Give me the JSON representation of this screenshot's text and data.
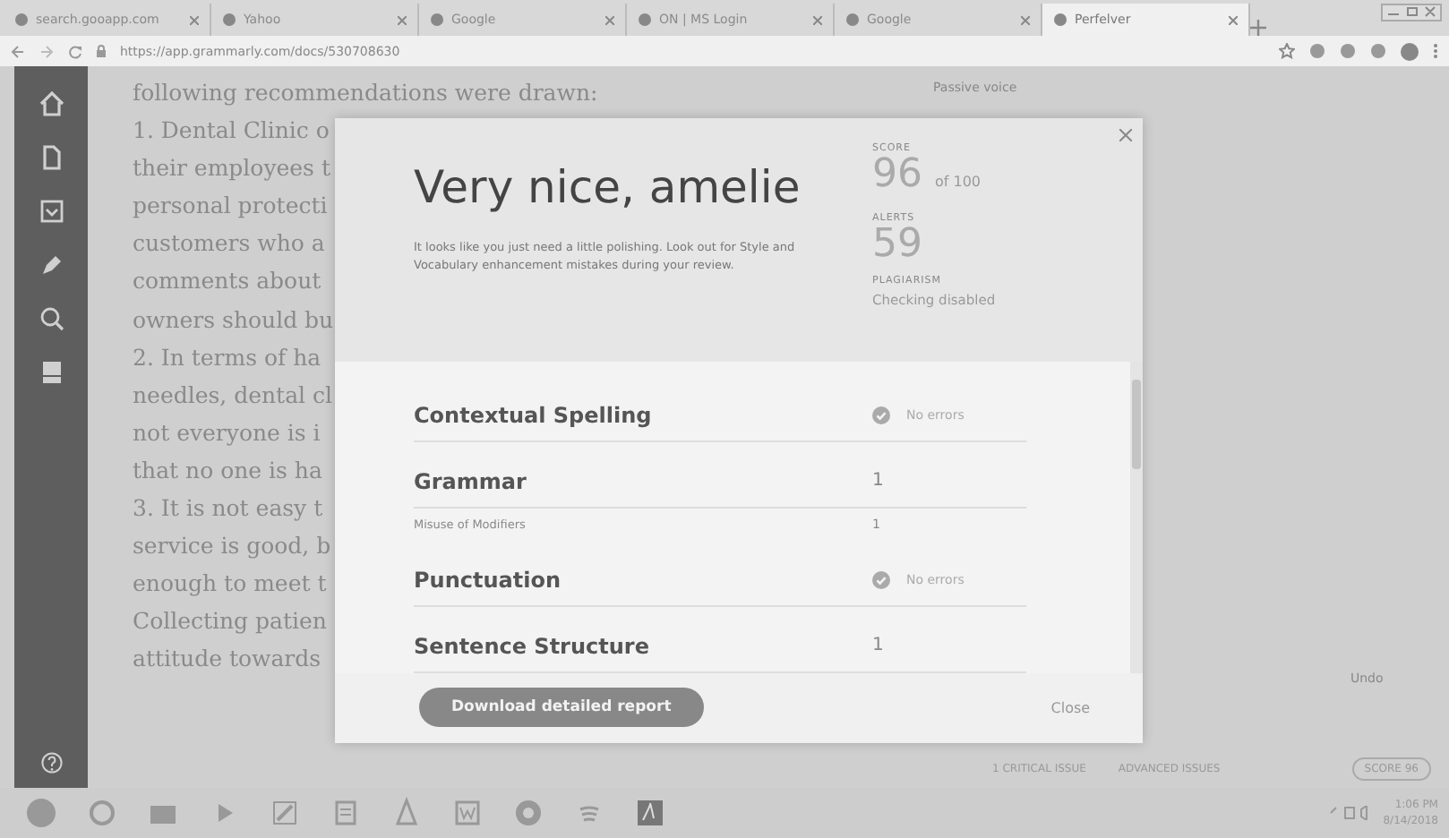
{
  "browser": {
    "tabs": [
      {
        "title": "search.gooapp.com",
        "selected": false
      },
      {
        "title": "Yahoo",
        "selected": false
      },
      {
        "title": "Google",
        "selected": false
      },
      {
        "title": "ON | MS Login",
        "selected": false
      },
      {
        "title": "Google",
        "selected": false
      },
      {
        "title": "Perfelver",
        "selected": true
      }
    ],
    "url": "https://app.grammarly.com/docs/530708630"
  },
  "document": {
    "lines": [
      "following recommendations were drawn:",
      "1. Dental Clinic o",
      "their employees t",
      "personal protecti",
      "customers who a",
      "comments about",
      "owners should bu",
      "2. In terms of ha",
      "needles, dental cl",
      "not everyone is i",
      "that no one is ha",
      "3. It is not easy t",
      "service is good, b",
      "enough to meet t",
      "Collecting patien",
      "attitude towards"
    ],
    "side_label": "Passive voice",
    "undo": "Undo",
    "status_bar": {
      "critical": "1 CRITICAL ISSUE",
      "advanced": "ADVANCED ISSUES",
      "score": "SCORE 96"
    }
  },
  "report": {
    "title": "Very nice, amelie",
    "message": "It looks like you just need a little polishing. Look out for Style and Vocabulary enhancement mistakes during your review.",
    "score": {
      "label": "SCORE",
      "value": "96",
      "suffix": "of 100"
    },
    "alerts": {
      "label": "ALERTS",
      "value": "59"
    },
    "plagiarism": {
      "label": "PLAGIARISM",
      "value": "Checking disabled"
    },
    "categories": [
      {
        "name": "Contextual Spelling",
        "kind": "clean",
        "result": "No errors"
      },
      {
        "name": "Grammar",
        "kind": "count",
        "result": "1",
        "subitems": [
          {
            "name": "Misuse of Modifiers",
            "count": "1"
          }
        ]
      },
      {
        "name": "Punctuation",
        "kind": "clean",
        "result": "No errors"
      },
      {
        "name": "Sentence Structure",
        "kind": "count",
        "result": "1"
      }
    ],
    "download_button": "Download detailed report",
    "close_button": "Close"
  },
  "taskbar": {
    "time": "1:06 PM",
    "date": "8/14/2018"
  }
}
